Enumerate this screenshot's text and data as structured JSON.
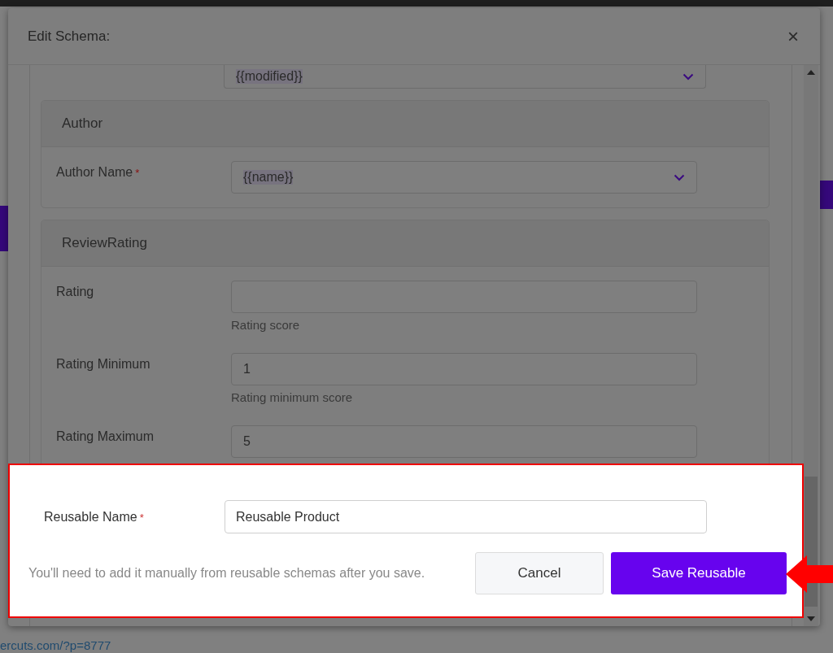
{
  "background": {
    "link": "ercuts.com/?p=8777"
  },
  "window": {
    "title": "Edit Schema:",
    "close": "×"
  },
  "top_field": {
    "value": "{{modified}}"
  },
  "sections": [
    {
      "title": "Author",
      "fields": [
        {
          "kind": "select",
          "label": "Author Name",
          "required_mark": "*",
          "value": "{{name}}"
        }
      ]
    },
    {
      "title": "ReviewRating",
      "fields": [
        {
          "kind": "text",
          "label": "Rating",
          "help": "Rating score"
        },
        {
          "kind": "text",
          "label": "Rating Minimum",
          "value": "1",
          "help": "Rating minimum score"
        },
        {
          "kind": "text",
          "label": "Rating Maximum",
          "value": "5"
        }
      ]
    }
  ],
  "reusable": {
    "label": "Reusable Name",
    "required_mark": "*",
    "value": "Reusable Product",
    "note": "You'll need to add it manually from reusable schemas after you save.",
    "buttons": [
      {
        "label": "Cancel",
        "kind": "secondary"
      },
      {
        "label": "Save Reusable",
        "kind": "primary"
      }
    ]
  }
}
